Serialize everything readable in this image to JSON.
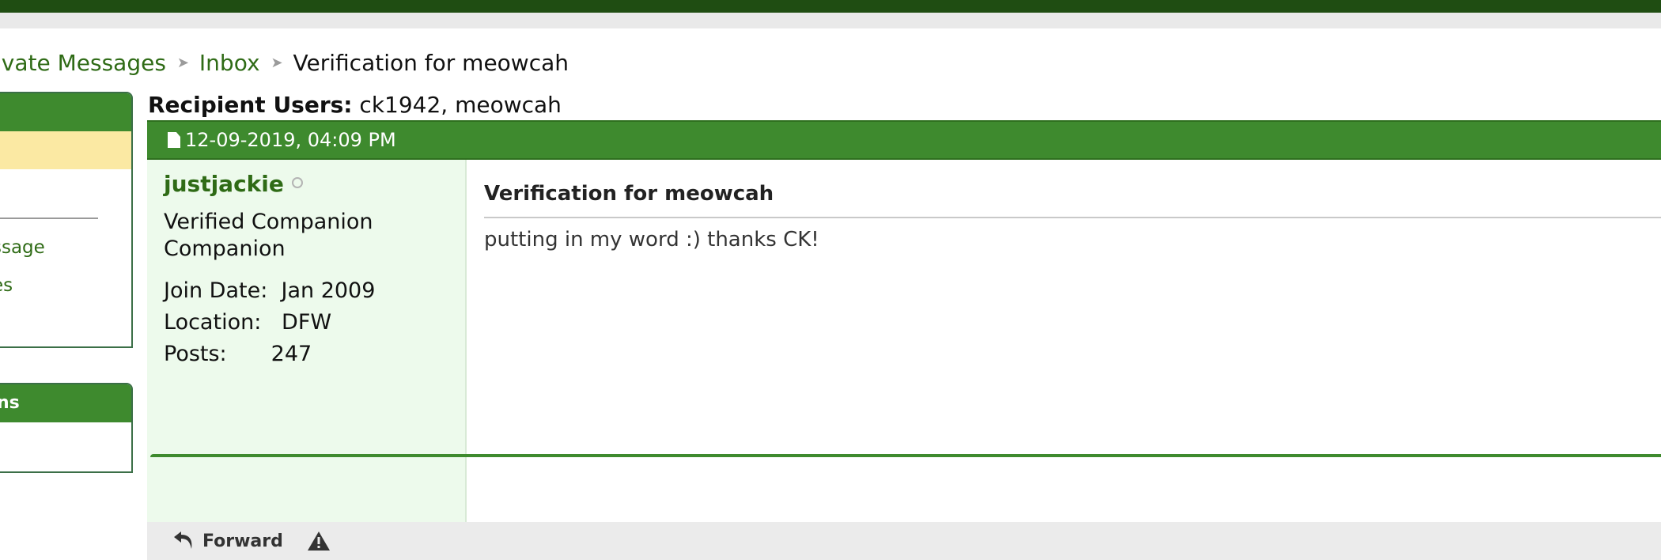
{
  "breadcrumb": {
    "items": [
      "ivate Messages",
      "Inbox"
    ],
    "current": "Verification for meowcah"
  },
  "sidebar": {
    "links": [
      "ssage",
      "es"
    ],
    "section2_title": "ns"
  },
  "message": {
    "recipients_label": "Recipient Users:",
    "recipients_value": "ck1942, meowcah",
    "date": "12-09-2019, 04:09 PM",
    "author": {
      "username": "justjackie",
      "title_line1": "Verified Companion",
      "title_line2": "Companion",
      "join_label": "Join Date:",
      "join_value": "Jan 2009",
      "location_label": "Location:",
      "location_value": "DFW",
      "posts_label": "Posts:",
      "posts_value": "247"
    },
    "title": "Verification for meowcah",
    "body": "putting in my word :) thanks CK!",
    "forward_label": "Forward"
  },
  "colors": {
    "header_green": "#3e8a2e",
    "link_green": "#2f6b16",
    "user_panel": "#edfaec",
    "highlight_yellow": "#fbe9a3"
  }
}
